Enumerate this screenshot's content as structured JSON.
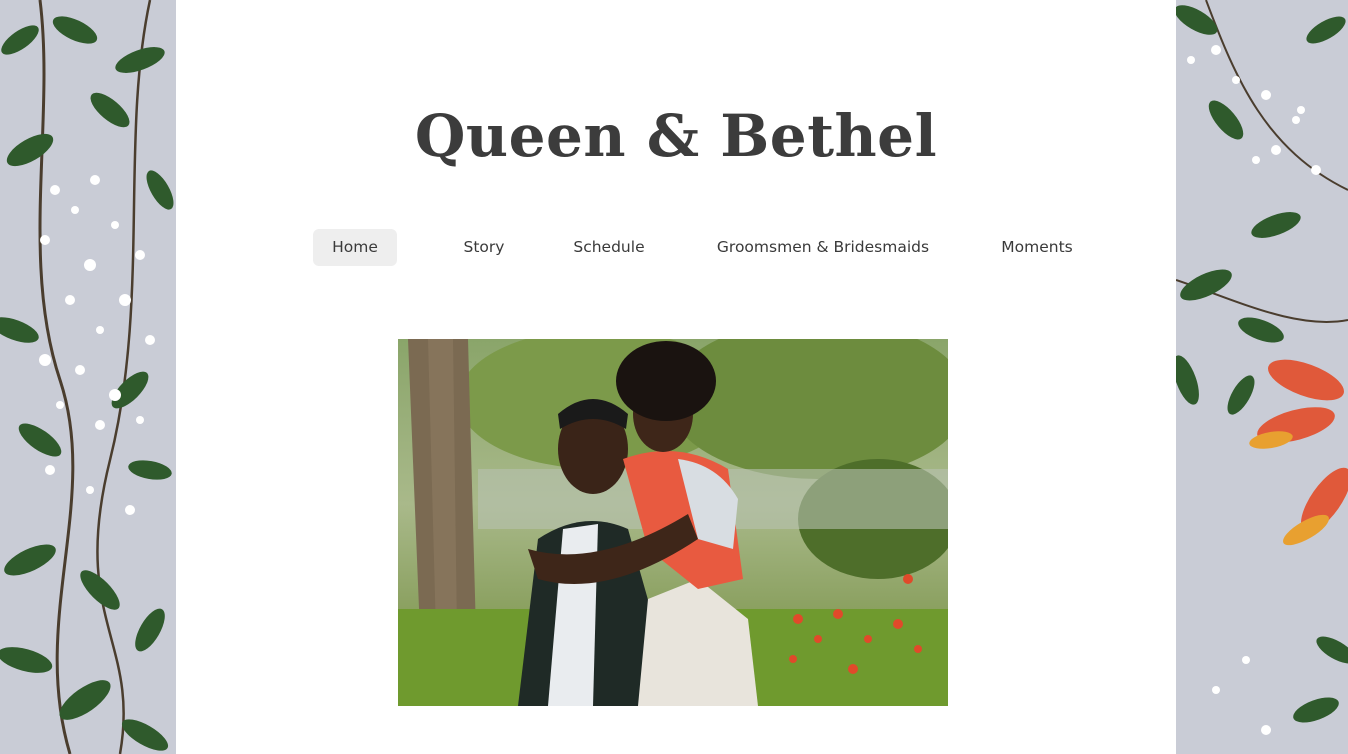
{
  "site": {
    "title": "Queen & Bethel"
  },
  "nav": {
    "items": [
      {
        "label": "Home",
        "active": true
      },
      {
        "label": "Story",
        "active": false
      },
      {
        "label": "Schedule",
        "active": false
      },
      {
        "label": "Groomsmen & Bridesmaids",
        "active": false
      },
      {
        "label": "Moments",
        "active": false
      }
    ]
  },
  "colors": {
    "panel_bg": "#ffffff",
    "side_bg": "#c9ccd6",
    "text": "#3c3c3c",
    "nav_active_bg": "#eeeeee",
    "leaf": "#2f5a2c",
    "flower": "#ffffff",
    "accent_leaf": "#e0593a"
  },
  "hero": {
    "image": "couple-photo"
  }
}
